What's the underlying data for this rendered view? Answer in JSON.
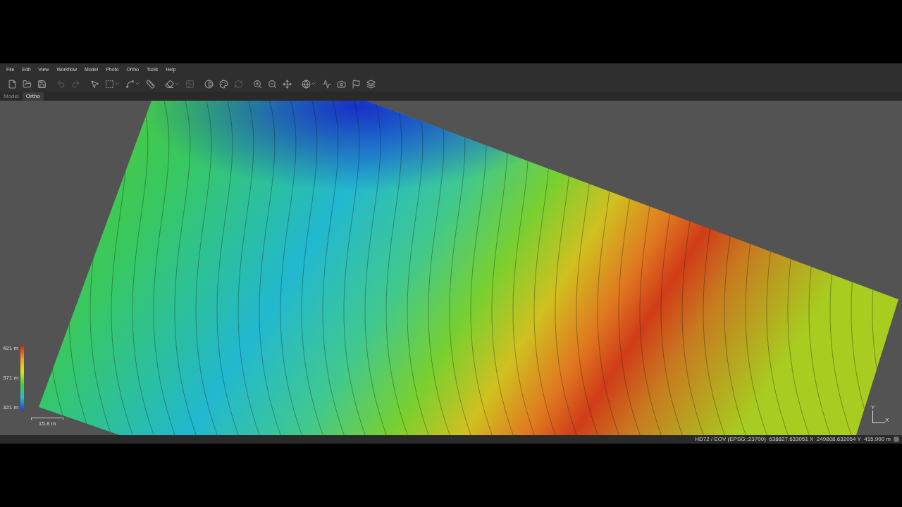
{
  "menu": [
    "File",
    "Edit",
    "View",
    "Workflow",
    "Model",
    "Photo",
    "Ortho",
    "Tools",
    "Help"
  ],
  "tabs": [
    {
      "label": "Model",
      "selected": false
    },
    {
      "label": "Ortho",
      "selected": true
    }
  ],
  "legend": {
    "max": "421 m",
    "mid": "371 m",
    "min": "321 m"
  },
  "scale_bar": "15.8 m",
  "axes": {
    "y": "Y",
    "x": "X"
  },
  "status_bar": "HD72 / EOV (EPSG::23700)  638827.633051 X  249808.632054 Y  415.900 m"
}
